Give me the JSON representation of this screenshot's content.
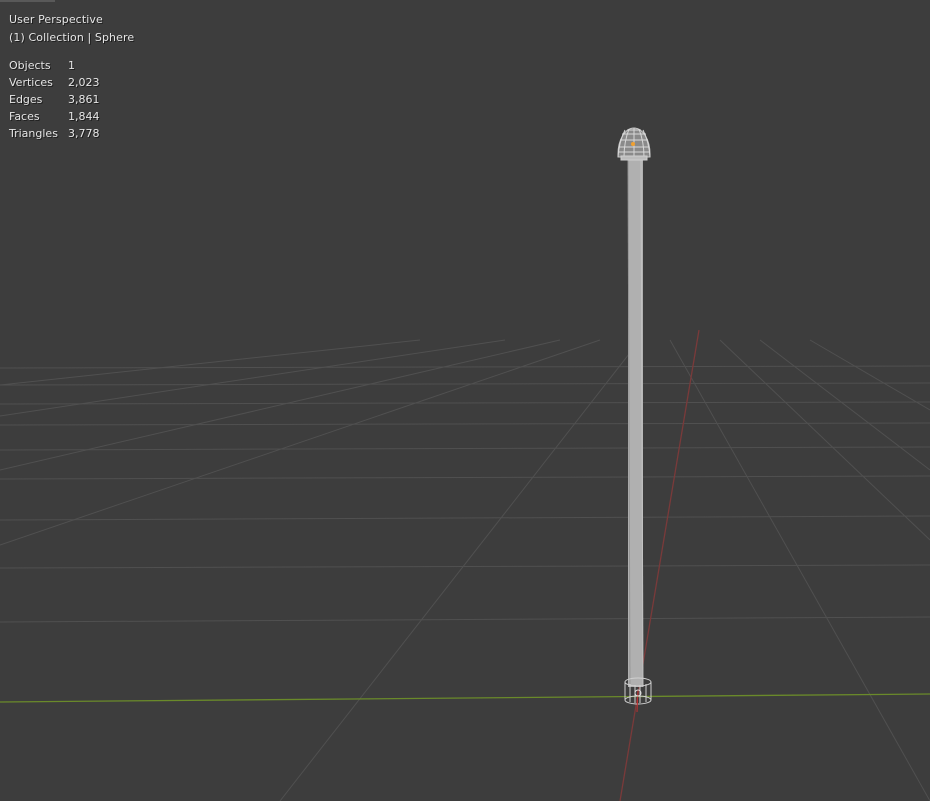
{
  "viewport": {
    "view_name": "User Perspective",
    "context_line": "(1) Collection | Sphere",
    "background_color": "#3d3d3d"
  },
  "statistics": [
    {
      "label": "Objects",
      "value": "1"
    },
    {
      "label": "Vertices",
      "value": "2,023"
    },
    {
      "label": "Edges",
      "value": "3,861"
    },
    {
      "label": "Faces",
      "value": "1,844"
    },
    {
      "label": "Triangles",
      "value": "3,778"
    }
  ],
  "colors": {
    "grid_line": "#505050",
    "x_axis": "#7a3a3a",
    "y_axis": "#6a8a2a",
    "mesh": "#b4b4b4",
    "wire": "#c8c8c8",
    "origin": "#f0a030"
  }
}
